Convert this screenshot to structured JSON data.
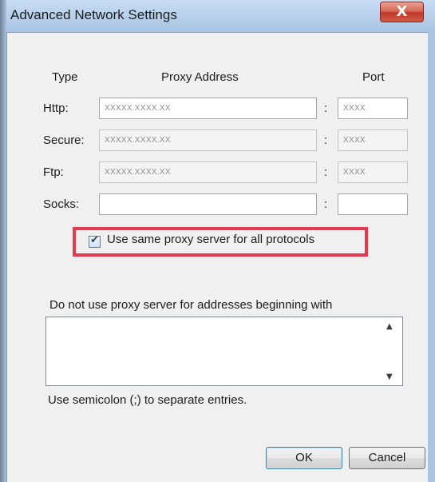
{
  "window": {
    "title": "Advanced Network Settings",
    "close_glyph": "X"
  },
  "headers": {
    "type": "Type",
    "proxy_address": "Proxy Address",
    "port": "Port"
  },
  "rows": [
    {
      "label": "Http:",
      "address": "XXXXX.XXXX.XX",
      "port": "XXXX",
      "enabled": true
    },
    {
      "label": "Secure:",
      "address": "XXXXX.XXXX.XX",
      "port": "XXXX",
      "enabled": false
    },
    {
      "label": "Ftp:",
      "address": "XXXXX.XXXX.XX",
      "port": "XXXX",
      "enabled": false
    },
    {
      "label": "Socks:",
      "address": "",
      "port": "",
      "enabled": true
    }
  ],
  "separator": ":",
  "same_proxy": {
    "label": "Use same proxy server for all protocols",
    "checked": true,
    "highlight_color": "#e6384f"
  },
  "bypass": {
    "label": "Do not use proxy server for addresses beginning with",
    "value": "",
    "hint": "Use semicolon (;) to separate entries."
  },
  "buttons": {
    "ok": "OK",
    "cancel": "Cancel"
  },
  "icons": {
    "close": "close-icon",
    "checkmark": "checkmark-icon",
    "scroll_up": "scroll-up-arrow-icon",
    "scroll_down": "scroll-down-arrow-icon"
  }
}
